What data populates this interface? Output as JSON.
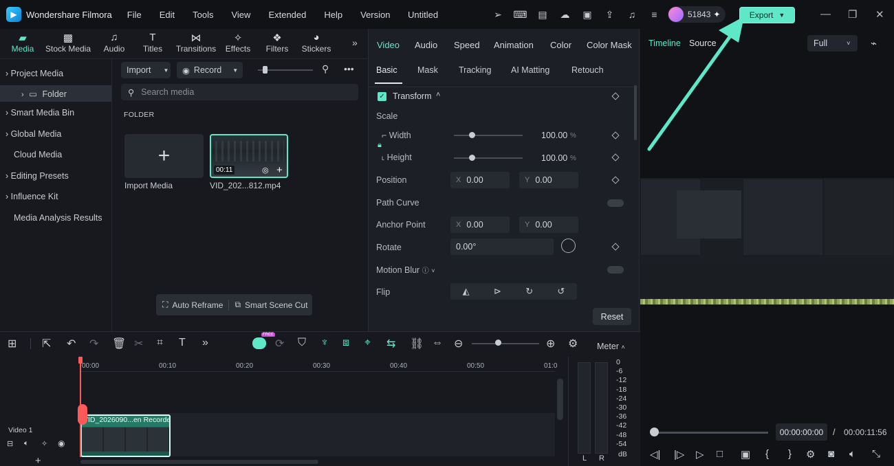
{
  "app": {
    "name": "Wondershare Filmora",
    "doc_title": "Untitled",
    "menu": [
      "File",
      "Edit",
      "Tools",
      "View",
      "Extended",
      "Help",
      "Version"
    ],
    "user_credits": "51843",
    "export_label": "Export"
  },
  "media_tabs": [
    {
      "label": "Media",
      "icon": "media-icon"
    },
    {
      "label": "Stock Media",
      "icon": "stock-media-icon"
    },
    {
      "label": "Audio",
      "icon": "music-note-icon"
    },
    {
      "label": "Titles",
      "icon": "text-icon"
    },
    {
      "label": "Transitions",
      "icon": "transition-icon"
    },
    {
      "label": "Effects",
      "icon": "effects-icon"
    },
    {
      "label": "Filters",
      "icon": "filters-icon"
    },
    {
      "label": "Stickers",
      "icon": "stickers-icon"
    }
  ],
  "sidebar": {
    "items": [
      "Project Media",
      "Folder",
      "Smart Media Bin",
      "Global Media",
      "Cloud Media",
      "Editing Presets",
      "Influence Kit",
      "Media Analysis Results"
    ]
  },
  "media": {
    "import_label": "Import",
    "record_label": "Record",
    "search_placeholder": "Search media",
    "folder_heading": "FOLDER",
    "import_media_caption": "Import Media",
    "clip_caption": "VID_202...812.mp4",
    "clip_duration": "00:11",
    "auto_reframe": "Auto Reframe",
    "smart_scene_cut": "Smart Scene Cut"
  },
  "properties": {
    "tabs": [
      "Video",
      "Audio",
      "Speed",
      "Animation",
      "Color",
      "Color Mask"
    ],
    "subtabs": [
      "Basic",
      "Mask",
      "Tracking",
      "AI Matting",
      "Retouch"
    ],
    "transform_label": "Transform",
    "scale_label": "Scale",
    "width_label": "Width",
    "height_label": "Height",
    "width_value": "100.00",
    "height_value": "100.00",
    "percent": "%",
    "position_label": "Position",
    "pos_x": "0.00",
    "pos_y": "0.00",
    "path_curve_label": "Path Curve",
    "anchor_label": "Anchor Point",
    "anchor_x": "0.00",
    "anchor_y": "0.00",
    "rotate_label": "Rotate",
    "rotate_value": "0.00°",
    "motion_blur_label": "Motion Blur",
    "flip_label": "Flip",
    "x_axis": "X",
    "y_axis": "Y",
    "reset_label": "Reset"
  },
  "preview": {
    "tabs": [
      "Timeline",
      "Source"
    ],
    "zoom": "Full",
    "current_time": "00:00:00:00",
    "separator": "/",
    "total_time": "00:00:11:56"
  },
  "timeline": {
    "ruler": [
      "00:00",
      "00:10",
      "00:20",
      "00:30",
      "00:40",
      "00:50",
      "01:0"
    ],
    "meter_label": "Meter",
    "track_label": "Video 1",
    "clip_label": "VID_2026090...en Recorder",
    "db_scale": [
      "0",
      "-6",
      "-12",
      "-18",
      "-24",
      "-30",
      "-36",
      "-42",
      "-48",
      "-54",
      "dB"
    ],
    "channels": [
      "L",
      "R"
    ],
    "free_badge": "FREE"
  },
  "colors": {
    "accent": "#5ee8c8",
    "playhead": "#ff5a5a"
  }
}
